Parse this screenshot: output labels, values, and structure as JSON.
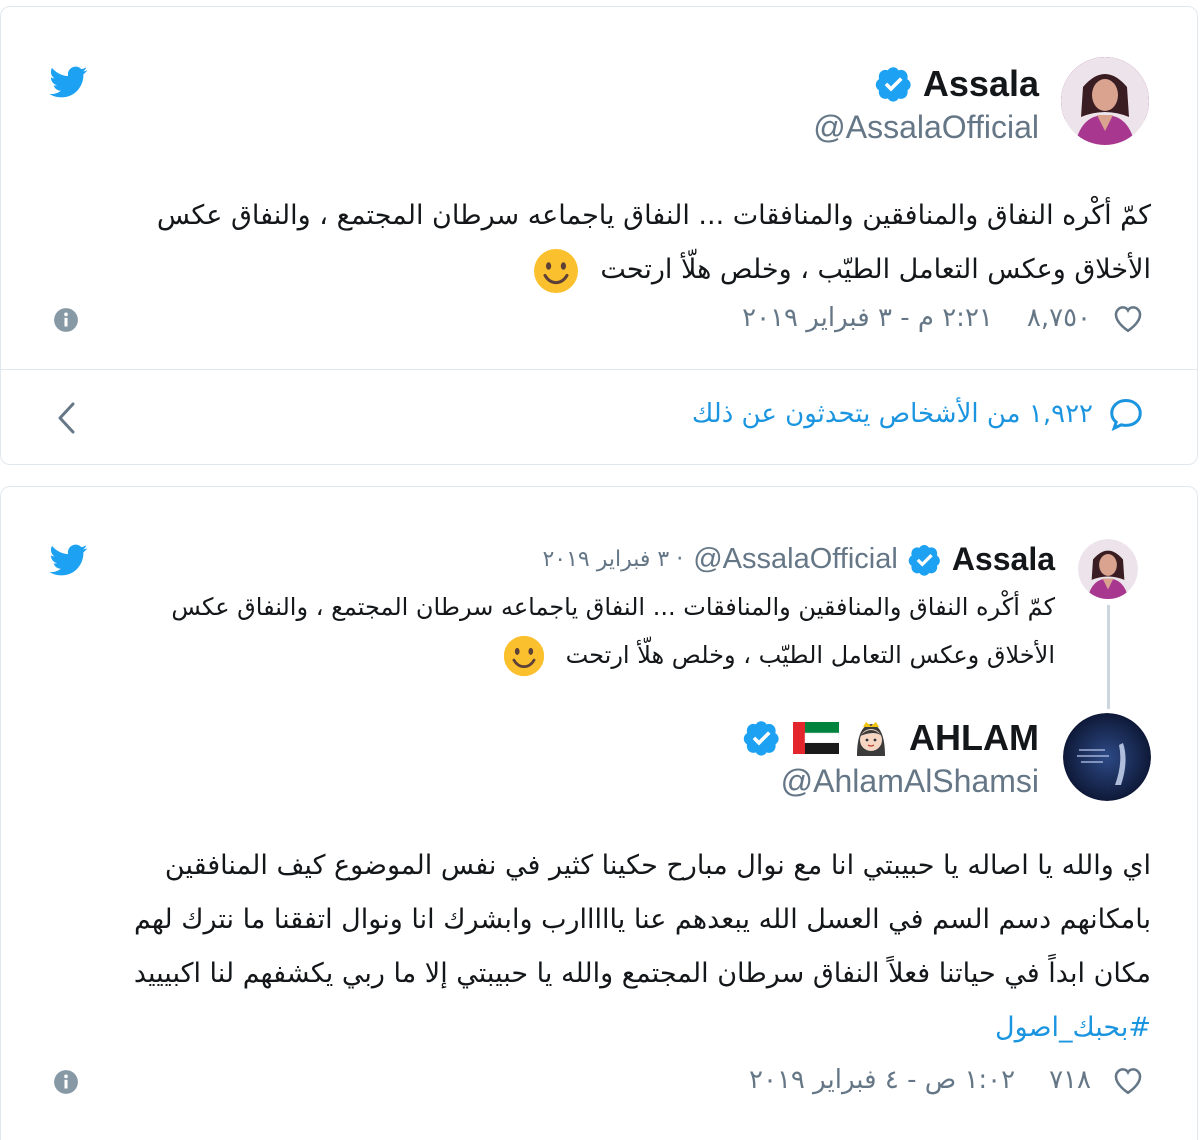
{
  "tweet1": {
    "name": "Assala",
    "handle": "@AssalaOfficial",
    "text_line1": "كمّ أكْره النفاق والمنافقين والمنافقات ... النفاق ياجماعه سرطان المجتمع ، والنفاق عكس",
    "text_line2": "الأخلاق وعكس التعامل الطيّب ، وخلص هلّأ ارتحت",
    "likes": "٨,٧٥٠",
    "datetime": "٢:٢١ م - ٣ فبراير ٢٠١٩",
    "conversation": "١,٩٢٢ من الأشخاص يتحدثون عن ذلك"
  },
  "tweet2": {
    "quoted": {
      "name": "Assala",
      "handle": "@AssalaOfficial",
      "date": "· ٣ فبراير ٢٠١٩",
      "text_line1": "كمّ أكْره النفاق والمنافقين والمنافقات ... النفاق ياجماعه سرطان المجتمع ، والنفاق عكس",
      "text_line2": "الأخلاق وعكس التعامل الطيّب ، وخلص هلّأ ارتحت"
    },
    "name": "AHLAM",
    "handle": "@AhlamAlShamsi",
    "text_line1": "اي والله يا اصاله يا حبيبتي انا مع نوال مبارح حكينا كثير في نفس الموضوع كيف المنافقين",
    "text_line2": "بامكانهم دسم السم في العسل الله يبعدهم عنا يااااارب وابشرك انا ونوال اتفقنا ما نترك لهم",
    "text_line3": "مكان ابداً في حياتنا فعلاً النفاق سرطان المجتمع والله يا حبيبتي إلا ما ربي يكشفهم لنا اكبيييد",
    "hashtag": "#بحبك_اصول",
    "likes": "٧١٨",
    "datetime": "١:٠٢ ص - ٤ فبراير ٢٠١٩"
  },
  "colors": {
    "twitter_blue": "#1da1f2",
    "link_blue": "#1b95e0",
    "muted": "#657786",
    "emoji_yellow": "#fbc02d"
  },
  "icons": [
    "twitter-bird-icon",
    "verified-badge-icon",
    "info-icon",
    "heart-icon",
    "reply-bubble-icon",
    "chevron-left-icon",
    "smile-emoji-icon",
    "uae-flag-icon",
    "person-emoji-icon"
  ]
}
